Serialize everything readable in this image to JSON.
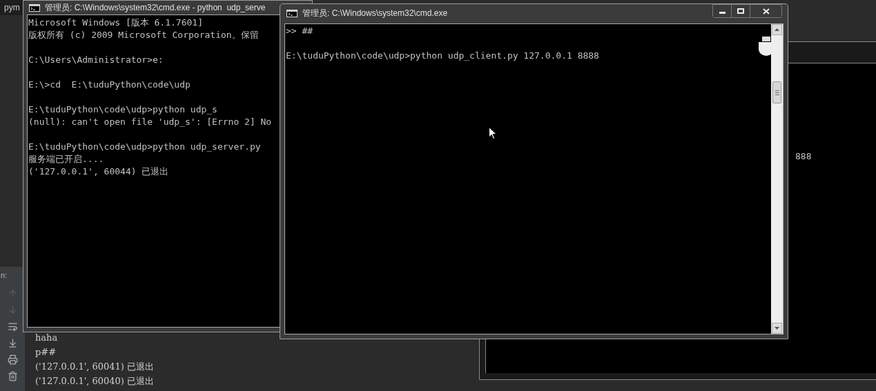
{
  "ide": {
    "tab_fragment": "pym",
    "run_label": "n:",
    "console_lines": [
      "haha",
      "p##",
      "('127.0.0.1', 60041) 已退出",
      "('127.0.0.1', 60040) 已退出"
    ]
  },
  "back_window": {
    "text_fragment": "888"
  },
  "server_window": {
    "title": "管理员: C:\\Windows\\system32\\cmd.exe - python  udp_serve",
    "blocks": [
      [
        "Microsoft Windows [版本 6.1.7601]",
        "版权所有 (c) 2009 Microsoft Corporation。保留"
      ],
      [
        "C:\\Users\\Administrator>e:"
      ],
      [
        "E:\\>cd  E:\\tuduPython\\code\\udp"
      ],
      [
        "E:\\tuduPython\\code\\udp>python udp_s",
        "(null): can't open file 'udp_s': [Errno 2] No"
      ],
      [
        "E:\\tuduPython\\code\\udp>python udp_server.py",
        "服务端已开启....",
        "('127.0.0.1', 60044) 已退出"
      ]
    ]
  },
  "client_window": {
    "title": "管理员: C:\\Windows\\system32\\cmd.exe",
    "blocks": [
      [
        ">> ##"
      ],
      [
        "E:\\tuduPython\\code\\udp>python udp_client.py 127.0.0.1 8888"
      ]
    ]
  }
}
